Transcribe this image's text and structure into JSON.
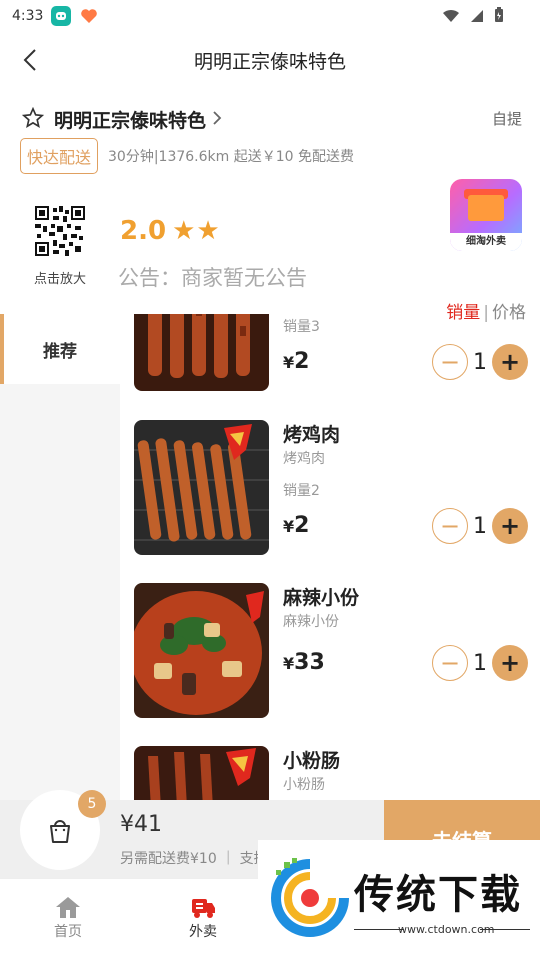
{
  "status": {
    "time": "4:33"
  },
  "nav": {
    "title": "明明正宗傣味特色"
  },
  "shop": {
    "name": "明明正宗傣味特色",
    "pickup": "自提",
    "delivery_tag": "快达配送",
    "meta": "30分钟|1376.6km   起送￥10   免配送费",
    "qr_caption": "点击放大",
    "rating": "2.0",
    "stars": "★★",
    "notice": "公告：商家暂无公告",
    "logo_caption": "细淘外卖"
  },
  "sort": {
    "active": "销量",
    "sep": "|",
    "inactive": "价格"
  },
  "sidebar": {
    "items": [
      {
        "label": "推荐"
      }
    ]
  },
  "products": [
    {
      "name": "",
      "sub": "",
      "sales": "销量3",
      "currency": "¥",
      "price": "2",
      "qty": "1",
      "image": "grilled-skewers"
    },
    {
      "name": "烤鸡肉",
      "sub": "烤鸡肉",
      "sales": "销量2",
      "currency": "¥",
      "price": "2",
      "qty": "1",
      "image": "grilled-chicken"
    },
    {
      "name": "麻辣小份",
      "sub": "麻辣小份",
      "sales": "",
      "currency": "¥",
      "price": "33",
      "qty": "1",
      "image": "spicy-hotpot"
    },
    {
      "name": "小粉肠",
      "sub": "小粉肠",
      "sales": "",
      "currency": "",
      "price": "",
      "qty": "",
      "image": "sausages"
    }
  ],
  "cart": {
    "count": "5",
    "total": "¥41",
    "note": "另需配送费¥10 ｜ 支持",
    "checkout": "去结算"
  },
  "tabs": [
    {
      "label": "首页"
    },
    {
      "label": "外卖"
    }
  ],
  "watermark": {
    "text": "传统下载",
    "domain": "www.ctdown.com"
  },
  "colors": {
    "accent": "#e2a766",
    "rating": "#f0a030",
    "sort_active": "#e0281e"
  }
}
